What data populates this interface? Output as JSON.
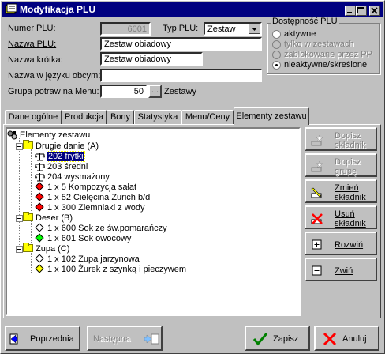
{
  "window": {
    "title": "Modyfikacja PLU"
  },
  "form": {
    "numer_label": "Numer PLU:",
    "numer_value": "6001",
    "typ_label": "Typ PLU:",
    "typ_value": "Zestaw",
    "nazwa_label": "Nazwa PLU:",
    "nazwa_value": "Zestaw obiadowy",
    "krotka_label": "Nazwa krótka:",
    "krotka_value": "Zestaw obiadowy",
    "obcy_label": "Nazwa w języku obcym:",
    "obcy_value": "",
    "grupa_label": "Grupa potraw na Menu:",
    "grupa_value": "50",
    "grupa_button": "...",
    "grupa_name": "Zestawy"
  },
  "availability": {
    "title": "Dostępność PLU",
    "options": [
      {
        "label": "aktywne",
        "enabled": true,
        "selected": false
      },
      {
        "label": "tylko w zestawach",
        "enabled": false,
        "selected": false
      },
      {
        "label": "zablokowane przez PP",
        "enabled": false,
        "selected": false
      },
      {
        "label": "nieaktywne/skreślone",
        "enabled": true,
        "selected": true
      }
    ]
  },
  "tabs": [
    {
      "label": "Dane ogólne",
      "active": false
    },
    {
      "label": "Produkcja",
      "active": false
    },
    {
      "label": "Bony",
      "active": false
    },
    {
      "label": "Statystyka",
      "active": false
    },
    {
      "label": "Menu/Ceny",
      "active": false
    },
    {
      "label": "Elementy zestawu",
      "active": true
    }
  ],
  "tree": {
    "root": "Elementy zestawu",
    "groups": [
      {
        "label": "Drugie danie (A)",
        "items": [
          {
            "label": "202 frytki",
            "icon": "scale-icon",
            "selected": true
          },
          {
            "label": "203 średni",
            "icon": "scale-icon",
            "selected": false
          },
          {
            "label": "204 wysmażony",
            "icon": "scale-icon",
            "selected": false
          },
          {
            "label": "1 x 5 Kompozycja sałat",
            "icon": "red-diamond-icon",
            "color": "#ff0000"
          },
          {
            "label": "1 x 52 Cielęcina Zurich b/d",
            "icon": "red-diamond-icon",
            "color": "#ff0000"
          },
          {
            "label": "1 x 300 Ziemniaki z wody",
            "icon": "red-diamond-icon",
            "color": "#ff0000"
          }
        ]
      },
      {
        "label": "Deser (B)",
        "items": [
          {
            "label": "1 x 600 Sok ze św.pomarańczy",
            "icon": "white-diamond-icon",
            "color": "#ffffff"
          },
          {
            "label": "1 x 601 Sok owocowy",
            "icon": "green-diamond-icon",
            "color": "#00ff00"
          }
        ]
      },
      {
        "label": "Zupa (C)",
        "items": [
          {
            "label": "1 x 102 Zupa jarzynowa",
            "icon": "white-diamond-icon",
            "color": "#ffffff"
          },
          {
            "label": "1 x 100 Żurek z szynką i pieczywem",
            "icon": "yellow-diamond-icon",
            "color": "#ffff00"
          }
        ]
      }
    ]
  },
  "side_buttons": [
    {
      "line1": "Dopisz",
      "line2": "składnik",
      "enabled": false
    },
    {
      "line1": "Dopisz",
      "line2": "grupę",
      "enabled": false
    },
    {
      "line1": "Zmień",
      "line2": "składnik",
      "enabled": true
    },
    {
      "line1": "Usuń",
      "line2": "składnik",
      "enabled": true
    },
    {
      "line1": "Rozwiń",
      "line2": "",
      "enabled": true
    },
    {
      "line1": "Zwiń",
      "line2": "",
      "enabled": true
    }
  ],
  "bottom": {
    "prev": "Poprzednia",
    "next": "Następna",
    "save": "Zapisz",
    "cancel": "Anuluj"
  },
  "colors": {
    "titlebar": "#000080",
    "selection": "#000080",
    "face": "#c0c0c0"
  }
}
